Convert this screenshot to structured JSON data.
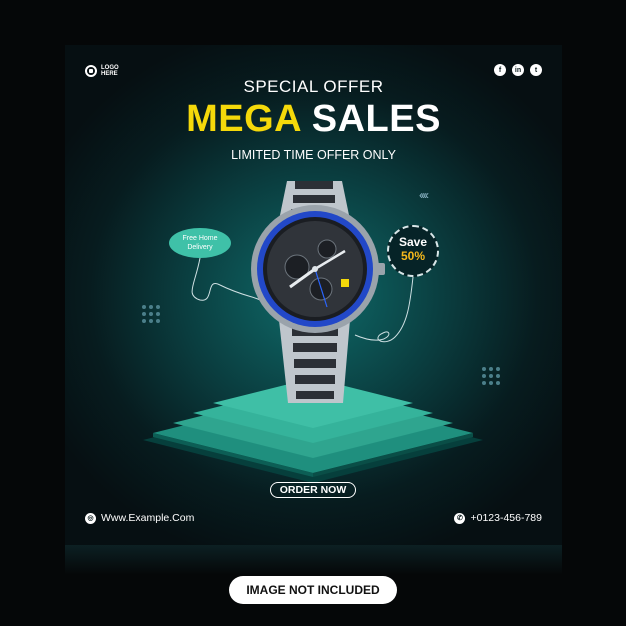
{
  "brand": {
    "logo_text": "LOGO HERE"
  },
  "socials": [
    {
      "icon": "facebook-icon",
      "glyph": "f"
    },
    {
      "icon": "linkedin-icon",
      "glyph": "in"
    },
    {
      "icon": "twitter-icon",
      "glyph": "t"
    }
  ],
  "headline": {
    "kicker": "SPECIAL OFFER",
    "highlight": "MEGA",
    "rest": "SALES",
    "subline": "LIMITED TIME OFFER ONLY"
  },
  "badges": {
    "delivery": "Free Home Delivery",
    "save_label": "Save",
    "save_value": "50%"
  },
  "cta": {
    "order": "ORDER NOW"
  },
  "footer": {
    "website": "Www.Example.Com",
    "phone": "+0123-456-789"
  },
  "notice": "IMAGE NOT INCLUDED",
  "colors": {
    "accent_yellow": "#f5d90a",
    "accent_orange": "#f5b81c",
    "teal": "#3fc1a8",
    "bezel_blue": "#2248c8"
  }
}
